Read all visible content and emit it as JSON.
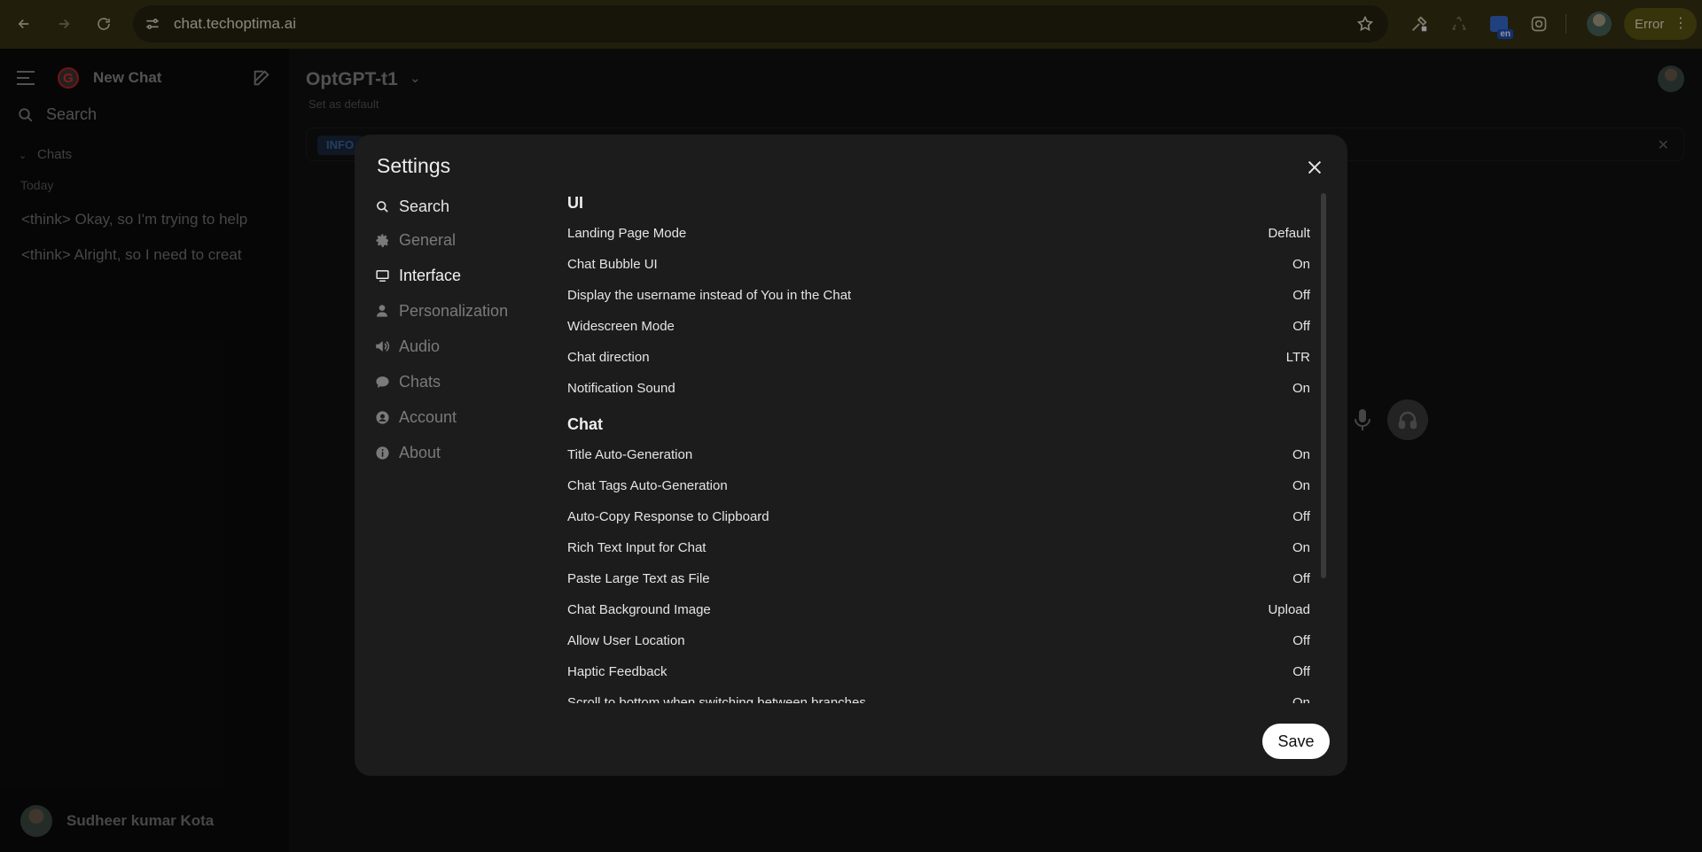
{
  "browser": {
    "url": "chat.techoptima.ai",
    "error_label": "Error",
    "ext_badge": "en"
  },
  "sidebar": {
    "title": "New Chat",
    "search": "Search",
    "chats_label": "Chats",
    "today_label": "Today",
    "items": [
      "<think> Okay, so I'm trying to help",
      "<think> Alright, so I need to creat"
    ],
    "user_name": "Sudheer kumar Kota"
  },
  "main": {
    "model_name": "OptGPT-t1",
    "set_default": "Set as default",
    "info_tag": "INFO"
  },
  "settings": {
    "title": "Settings",
    "nav": [
      {
        "label": "Search",
        "icon": "search-icon"
      },
      {
        "label": "General",
        "icon": "gear-icon"
      },
      {
        "label": "Interface",
        "icon": "monitor-icon"
      },
      {
        "label": "Personalization",
        "icon": "user-icon"
      },
      {
        "label": "Audio",
        "icon": "speaker-icon"
      },
      {
        "label": "Chats",
        "icon": "chat-bubble-icon"
      },
      {
        "label": "Account",
        "icon": "account-circle-icon"
      },
      {
        "label": "About",
        "icon": "info-icon"
      }
    ],
    "active_nav": "Interface",
    "sections": [
      {
        "title": "UI",
        "rows": [
          {
            "label": "Landing Page Mode",
            "value": "Default"
          },
          {
            "label": "Chat Bubble UI",
            "value": "On"
          },
          {
            "label": "Display the username instead of You in the Chat",
            "value": "Off"
          },
          {
            "label": "Widescreen Mode",
            "value": "Off"
          },
          {
            "label": "Chat direction",
            "value": "LTR"
          },
          {
            "label": "Notification Sound",
            "value": "On"
          }
        ]
      },
      {
        "title": "Chat",
        "rows": [
          {
            "label": "Title Auto-Generation",
            "value": "On"
          },
          {
            "label": "Chat Tags Auto-Generation",
            "value": "On"
          },
          {
            "label": "Auto-Copy Response to Clipboard",
            "value": "Off"
          },
          {
            "label": "Rich Text Input for Chat",
            "value": "On"
          },
          {
            "label": "Paste Large Text as File",
            "value": "Off"
          },
          {
            "label": "Chat Background Image",
            "value": "Upload"
          },
          {
            "label": "Allow User Location",
            "value": "Off"
          },
          {
            "label": "Haptic Feedback",
            "value": "Off"
          },
          {
            "label": "Scroll to bottom when switching between branches",
            "value": "On"
          }
        ]
      }
    ],
    "save_label": "Save"
  }
}
